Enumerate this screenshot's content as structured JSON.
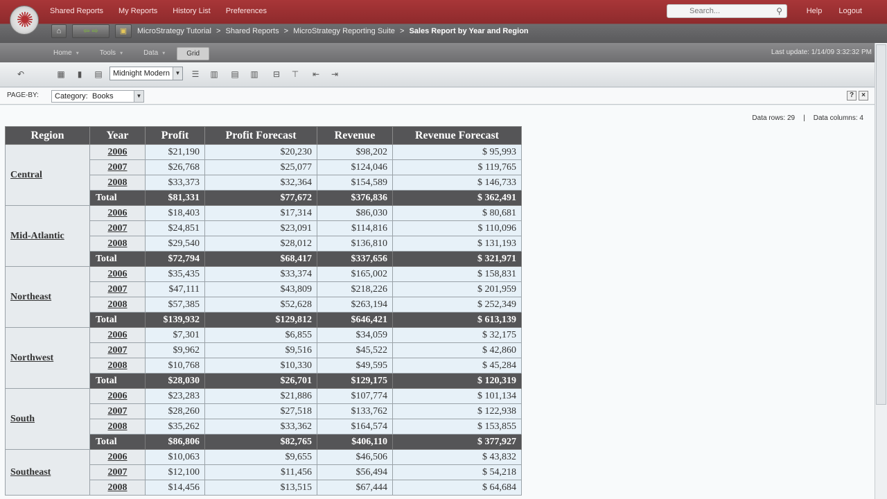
{
  "topnav": [
    "Shared Reports",
    "My Reports",
    "History List",
    "Preferences"
  ],
  "search": {
    "placeholder": "Search..."
  },
  "toplinks": {
    "help": "Help",
    "logout": "Logout"
  },
  "breadcrumb": {
    "items": [
      "MicroStrategy Tutorial",
      "Shared Reports",
      "MicroStrategy Reporting Suite"
    ],
    "current": "Sales Report by Year and Region",
    "separator": ">"
  },
  "menu": {
    "tabs": [
      "Home",
      "Tools",
      "Data",
      "Grid"
    ],
    "active": "Grid",
    "last_updated": "Last update: 1/14/09 3:32:32 PM"
  },
  "toolbar": {
    "style_value": "Midnight Modern"
  },
  "pageby": {
    "label": "PAGE-BY:",
    "category_label": "Category:",
    "category_value": "Books"
  },
  "stats": {
    "rows": "Data rows: 29",
    "cols": "Data columns: 4",
    "divider": "|"
  },
  "grid": {
    "headers": [
      "Region",
      "Year",
      "Profit",
      "Profit Forecast",
      "Revenue",
      "Revenue Forecast"
    ],
    "total_label": "Total",
    "groups": [
      {
        "region": "Central",
        "rows": [
          [
            "2006",
            "$21,190",
            "$20,230",
            "$98,202",
            "$ 95,993"
          ],
          [
            "2007",
            "$26,768",
            "$25,077",
            "$124,046",
            "$ 119,765"
          ],
          [
            "2008",
            "$33,373",
            "$32,364",
            "$154,589",
            "$ 146,733"
          ]
        ],
        "total": [
          "$81,331",
          "$77,672",
          "$376,836",
          "$ 362,491"
        ]
      },
      {
        "region": "Mid-Atlantic",
        "rows": [
          [
            "2006",
            "$18,403",
            "$17,314",
            "$86,030",
            "$ 80,681"
          ],
          [
            "2007",
            "$24,851",
            "$23,091",
            "$114,816",
            "$ 110,096"
          ],
          [
            "2008",
            "$29,540",
            "$28,012",
            "$136,810",
            "$ 131,193"
          ]
        ],
        "total": [
          "$72,794",
          "$68,417",
          "$337,656",
          "$ 321,971"
        ]
      },
      {
        "region": "Northeast",
        "rows": [
          [
            "2006",
            "$35,435",
            "$33,374",
            "$165,002",
            "$ 158,831"
          ],
          [
            "2007",
            "$47,111",
            "$43,809",
            "$218,226",
            "$ 201,959"
          ],
          [
            "2008",
            "$57,385",
            "$52,628",
            "$263,194",
            "$ 252,349"
          ]
        ],
        "total": [
          "$139,932",
          "$129,812",
          "$646,421",
          "$ 613,139"
        ]
      },
      {
        "region": "Northwest",
        "rows": [
          [
            "2006",
            "$7,301",
            "$6,855",
            "$34,059",
            "$ 32,175"
          ],
          [
            "2007",
            "$9,962",
            "$9,516",
            "$45,522",
            "$ 42,860"
          ],
          [
            "2008",
            "$10,768",
            "$10,330",
            "$49,595",
            "$ 45,284"
          ]
        ],
        "total": [
          "$28,030",
          "$26,701",
          "$129,175",
          "$ 120,319"
        ]
      },
      {
        "region": "South",
        "rows": [
          [
            "2006",
            "$23,283",
            "$21,886",
            "$107,774",
            "$ 101,134"
          ],
          [
            "2007",
            "$28,260",
            "$27,518",
            "$133,762",
            "$ 122,938"
          ],
          [
            "2008",
            "$35,262",
            "$33,362",
            "$164,574",
            "$ 153,855"
          ]
        ],
        "total": [
          "$86,806",
          "$82,765",
          "$406,110",
          "$ 377,927"
        ]
      },
      {
        "region": "Southeast",
        "rows": [
          [
            "2006",
            "$10,063",
            "$9,655",
            "$46,506",
            "$ 43,832"
          ],
          [
            "2007",
            "$12,100",
            "$11,456",
            "$56,494",
            "$ 54,218"
          ],
          [
            "2008",
            "$14,456",
            "$13,515",
            "$67,444",
            "$ 64,684"
          ]
        ]
      }
    ]
  },
  "colors": {
    "brand_red": "#a83638",
    "header_dark": "#555557",
    "cell_blue": "#e7f1f8"
  }
}
